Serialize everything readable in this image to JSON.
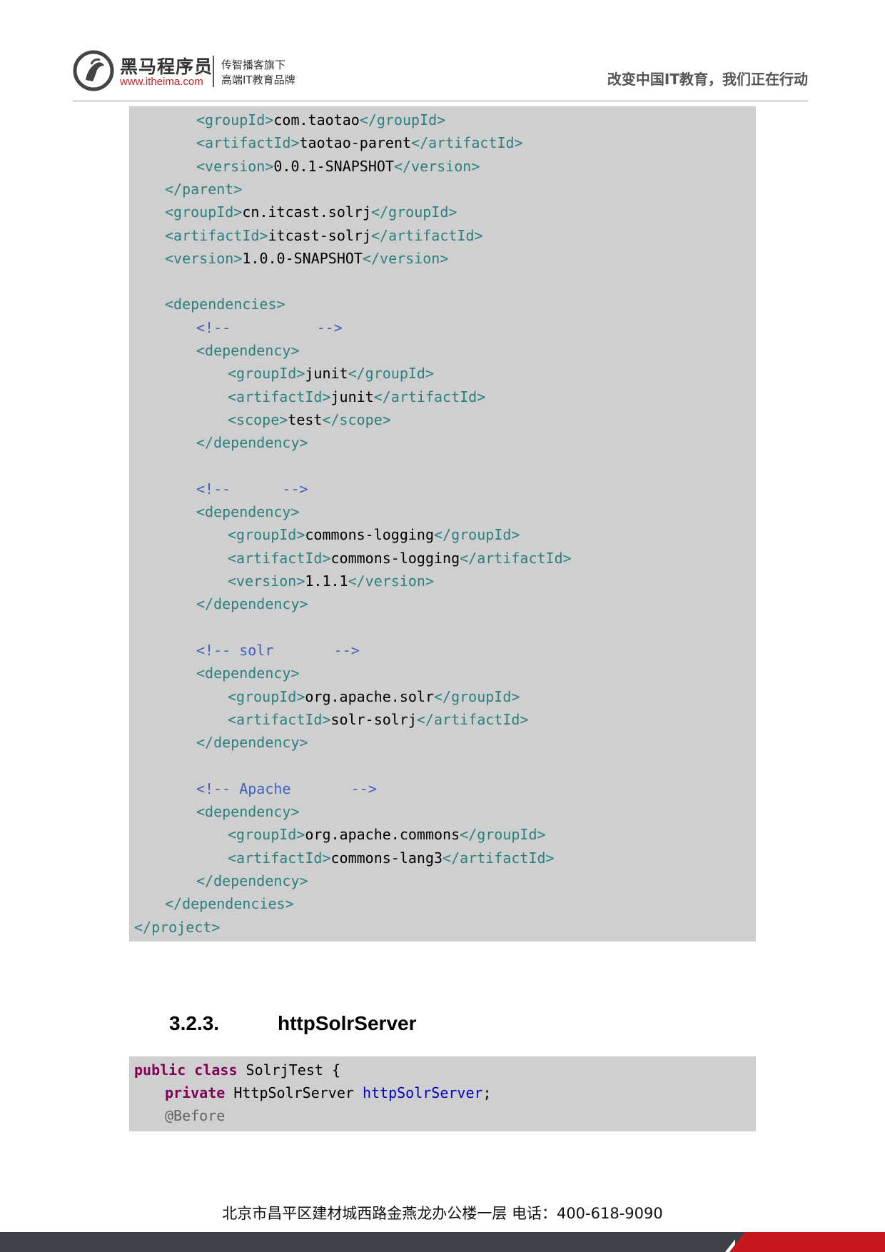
{
  "header": {
    "brand_name": "黑马程序员",
    "brand_url": "www.itheima.com",
    "slogan_line1": "传智播客旗下",
    "slogan_line2": "高端IT教育品牌",
    "tagline": "改变中国IT教育，我们正在行动"
  },
  "code_block_1": {
    "lines": [
      [
        {
          "t": "tag",
          "v": "<groupId>"
        },
        {
          "t": "txt",
          "v": "com.taotao"
        },
        {
          "t": "tag",
          "v": "</groupId>"
        }
      ],
      [
        {
          "t": "tag",
          "v": "<artifactId>"
        },
        {
          "t": "txt",
          "v": "taotao-parent"
        },
        {
          "t": "tag",
          "v": "</artifactId>"
        }
      ],
      [
        {
          "t": "tag",
          "v": "<version>"
        },
        {
          "t": "txt",
          "v": "0.0.1-SNAPSHOT"
        },
        {
          "t": "tag",
          "v": "</version>"
        }
      ],
      [
        {
          "t": "tag",
          "v": "</parent>"
        }
      ],
      [
        {
          "t": "tag",
          "v": "<groupId>"
        },
        {
          "t": "txt",
          "v": "cn.itcast.solrj"
        },
        {
          "t": "tag",
          "v": "</groupId>"
        }
      ],
      [
        {
          "t": "tag",
          "v": "<artifactId>"
        },
        {
          "t": "txt",
          "v": "itcast-solrj"
        },
        {
          "t": "tag",
          "v": "</artifactId>"
        }
      ],
      [
        {
          "t": "tag",
          "v": "<version>"
        },
        {
          "t": "txt",
          "v": "1.0.0-SNAPSHOT"
        },
        {
          "t": "tag",
          "v": "</version>"
        }
      ],
      [],
      [
        {
          "t": "tag",
          "v": "<dependencies>"
        }
      ],
      [
        {
          "t": "cmt",
          "v": "<!--          -->"
        }
      ],
      [
        {
          "t": "tag",
          "v": "<dependency>"
        }
      ],
      [
        {
          "t": "tag",
          "v": "<groupId>"
        },
        {
          "t": "txt",
          "v": "junit"
        },
        {
          "t": "tag",
          "v": "</groupId>"
        }
      ],
      [
        {
          "t": "tag",
          "v": "<artifactId>"
        },
        {
          "t": "txt",
          "v": "junit"
        },
        {
          "t": "tag",
          "v": "</artifactId>"
        }
      ],
      [
        {
          "t": "tag",
          "v": "<scope>"
        },
        {
          "t": "txt",
          "v": "test"
        },
        {
          "t": "tag",
          "v": "</scope>"
        }
      ],
      [
        {
          "t": "tag",
          "v": "</dependency>"
        }
      ],
      [],
      [
        {
          "t": "cmt",
          "v": "<!--      -->"
        }
      ],
      [
        {
          "t": "tag",
          "v": "<dependency>"
        }
      ],
      [
        {
          "t": "tag",
          "v": "<groupId>"
        },
        {
          "t": "txt",
          "v": "commons-logging"
        },
        {
          "t": "tag",
          "v": "</groupId>"
        }
      ],
      [
        {
          "t": "tag",
          "v": "<artifactId>"
        },
        {
          "t": "txt",
          "v": "commons-logging"
        },
        {
          "t": "tag",
          "v": "</artifactId>"
        }
      ],
      [
        {
          "t": "tag",
          "v": "<version>"
        },
        {
          "t": "txt",
          "v": "1.1.1"
        },
        {
          "t": "tag",
          "v": "</version>"
        }
      ],
      [
        {
          "t": "tag",
          "v": "</dependency>"
        }
      ],
      [],
      [
        {
          "t": "cmt",
          "v": "<!-- solr       -->"
        }
      ],
      [
        {
          "t": "tag",
          "v": "<dependency>"
        }
      ],
      [
        {
          "t": "tag",
          "v": "<groupId>"
        },
        {
          "t": "txt",
          "v": "org.apache.solr"
        },
        {
          "t": "tag",
          "v": "</groupId>"
        }
      ],
      [
        {
          "t": "tag",
          "v": "<artifactId>"
        },
        {
          "t": "txt",
          "v": "solr-solrj"
        },
        {
          "t": "tag",
          "v": "</artifactId>"
        }
      ],
      [
        {
          "t": "tag",
          "v": "</dependency>"
        }
      ],
      [],
      [
        {
          "t": "cmt",
          "v": "<!-- Apache       -->"
        }
      ],
      [
        {
          "t": "tag",
          "v": "<dependency>"
        }
      ],
      [
        {
          "t": "tag",
          "v": "<groupId>"
        },
        {
          "t": "txt",
          "v": "org.apache.commons"
        },
        {
          "t": "tag",
          "v": "</groupId>"
        }
      ],
      [
        {
          "t": "tag",
          "v": "<artifactId>"
        },
        {
          "t": "txt",
          "v": "commons-lang3"
        },
        {
          "t": "tag",
          "v": "</artifactId>"
        }
      ],
      [
        {
          "t": "tag",
          "v": "</dependency>"
        }
      ],
      [
        {
          "t": "tag",
          "v": "</dependencies>"
        }
      ],
      [
        {
          "t": "tag",
          "v": "</project>"
        }
      ]
    ]
  },
  "section": {
    "number": "3.2.3.",
    "title": "httpSolrServer"
  },
  "code_block_2": {
    "lines": [
      [
        {
          "t": "kw",
          "v": "public"
        },
        {
          "t": "txt",
          "v": " "
        },
        {
          "t": "kw",
          "v": "class"
        },
        {
          "t": "txt",
          "v": " SolrjTest {"
        }
      ],
      [
        {
          "t": "kw",
          "v": "private"
        },
        {
          "t": "txt",
          "v": " HttpSolrServer "
        },
        {
          "t": "fld",
          "v": "httpSolrServer"
        },
        {
          "t": "txt",
          "v": ";"
        }
      ],
      [
        {
          "t": "ann",
          "v": "@Before"
        }
      ]
    ]
  },
  "footer": {
    "address": "北京市昌平区建材城西路金燕龙办公楼一层   电话：400-618-9090"
  }
}
